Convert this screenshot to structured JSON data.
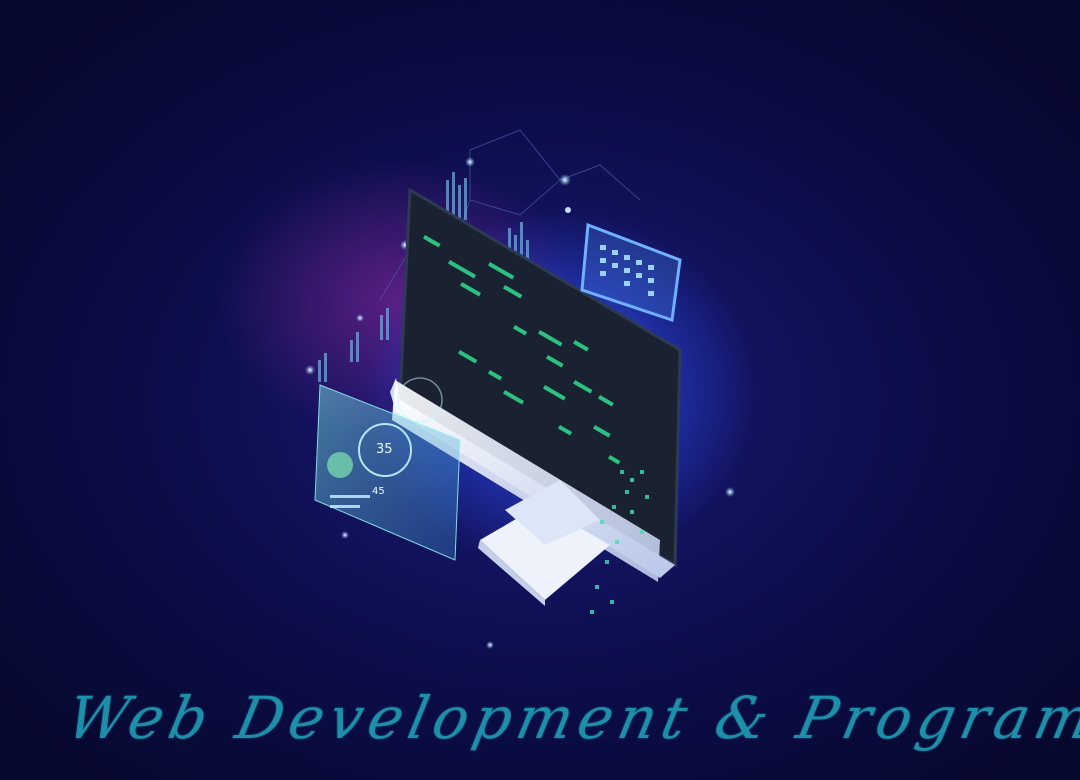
{
  "caption": "Web Development & Programming",
  "gauge_value": "35",
  "gauge_small_value": "45",
  "colors": {
    "background": "#0a0c3a",
    "glow": "#3c8cff",
    "caption": "#1d8fa8",
    "code_green": "#2fd38a",
    "monitor_screen": "#1b2230",
    "monitor_frame": "#e8eef8"
  }
}
